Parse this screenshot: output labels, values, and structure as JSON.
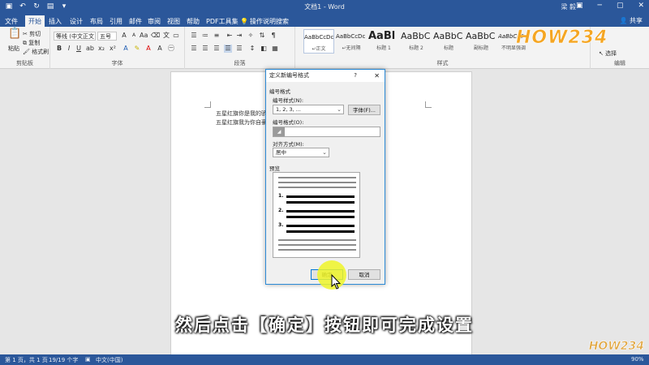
{
  "titlebar": {
    "doc_title": "文档1 - Word",
    "user_name": "梁 毅"
  },
  "tabs": [
    {
      "label": "文件"
    },
    {
      "label": "开始"
    },
    {
      "label": "插入"
    },
    {
      "label": "设计"
    },
    {
      "label": "布局"
    },
    {
      "label": "引用"
    },
    {
      "label": "邮件"
    },
    {
      "label": "审阅"
    },
    {
      "label": "视图"
    },
    {
      "label": "帮助"
    },
    {
      "label": "PDF工具集"
    },
    {
      "label": "操作说明搜索"
    }
  ],
  "share_label": "共享",
  "ribbon": {
    "clipboard": {
      "paste": "粘贴",
      "cut": "剪切",
      "copy": "复制",
      "format_painter": "格式刷",
      "label": "剪贴板"
    },
    "font": {
      "font_name": "等线 (中文正文",
      "font_size": "五号",
      "label": "字体",
      "bold": "B",
      "italic": "I",
      "underline": "U"
    },
    "paragraph": {
      "label": "段落"
    },
    "styles": {
      "label": "样式",
      "items": [
        {
          "sample": "AaBbCcDc",
          "name": "↵正文"
        },
        {
          "sample": "AaBbCcDc",
          "name": "↵无间隔"
        },
        {
          "sample": "AaBl",
          "name": "标题 1"
        },
        {
          "sample": "AaBbC",
          "name": "标题 2"
        },
        {
          "sample": "AaBbC",
          "name": "标题"
        },
        {
          "sample": "AaBbC",
          "name": "副标题"
        },
        {
          "sample": "AaBbCcDc",
          "name": "不明显强调"
        }
      ]
    },
    "editing": {
      "label": "编辑",
      "select": "选择"
    }
  },
  "document": {
    "lines": [
      "五星红旗你是我的骄傲",
      "五星红旗我为你自豪"
    ]
  },
  "dialog": {
    "title": "定义新编号格式",
    "help": "?",
    "close": "✕",
    "section_number_format": "编号格式",
    "number_style_label": "编号样式(N):",
    "number_style_value": "1, 2, 3, ...",
    "font_button": "字体(F)...",
    "number_format_label": "编号格式(O):",
    "alignment_label": "对齐方式(M):",
    "alignment_value": "居中",
    "preview_label": "预览",
    "preview_numbers": [
      "1.",
      "2.",
      "3."
    ],
    "ok": "确定",
    "cancel": "取消"
  },
  "subtitle": "然后点击【确定】按钮即可完成设置",
  "statusbar": {
    "page": "第 1 页，共 1 页",
    "words": "19/19 个字",
    "language": "中文(中国)",
    "zoom": "90%"
  },
  "watermark": {
    "top": "HOW234",
    "bottom": "HOW234"
  },
  "colors": {
    "word_blue": "#2b579a",
    "highlight_yellow": "#eef528",
    "watermark_orange": "#f5a623"
  }
}
